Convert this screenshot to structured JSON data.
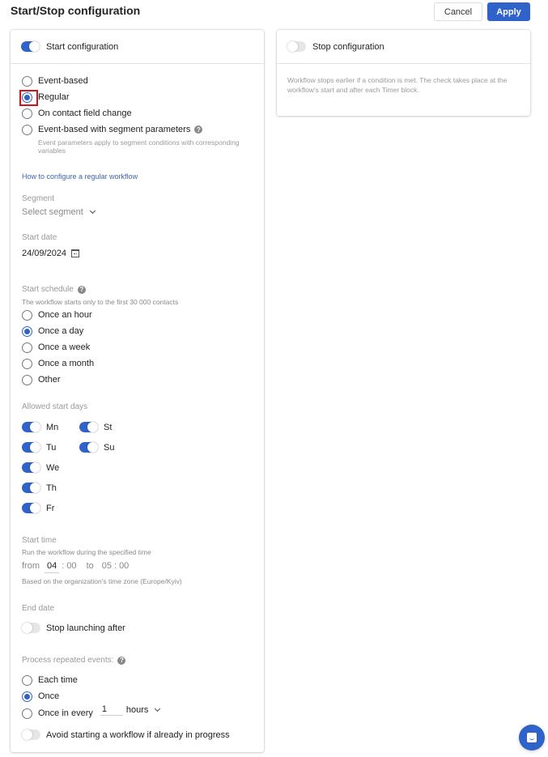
{
  "header": {
    "title": "Start/Stop configuration",
    "cancel_label": "Cancel",
    "apply_label": "Apply"
  },
  "colors": {
    "accent": "#2f63c9",
    "focus_outline": "#d0141c"
  },
  "start_card": {
    "toggle_label": "Start configuration",
    "toggle_on": true,
    "trigger_options": [
      {
        "label": "Event-based",
        "checked": false
      },
      {
        "label": "Regular",
        "checked": true
      },
      {
        "label": "On contact field change",
        "checked": false
      },
      {
        "label": "Event-based with segment parameters",
        "checked": false
      }
    ],
    "segment_params_note": "Event parameters apply to segment conditions with corresponding variables",
    "help_link": "How to configure a regular workflow",
    "segment": {
      "label": "Segment",
      "placeholder": "Select segment"
    },
    "start_date": {
      "label": "Start date",
      "value": "24/09/2024"
    },
    "start_schedule": {
      "label": "Start schedule",
      "note": "The workflow starts only to the first 30 000 contacts",
      "options": [
        {
          "label": "Once an hour",
          "checked": false
        },
        {
          "label": "Once a day",
          "checked": true
        },
        {
          "label": "Once a week",
          "checked": false
        },
        {
          "label": "Once a month",
          "checked": false
        },
        {
          "label": "Other",
          "checked": false
        }
      ]
    },
    "allowed_days": {
      "label": "Allowed start days",
      "days": [
        {
          "label": "Mn",
          "on": true
        },
        {
          "label": "Tu",
          "on": true
        },
        {
          "label": "We",
          "on": true
        },
        {
          "label": "Th",
          "on": true
        },
        {
          "label": "Fr",
          "on": true
        },
        {
          "label": "St",
          "on": true
        },
        {
          "label": "Su",
          "on": true
        }
      ]
    },
    "start_time": {
      "label": "Start time",
      "note": "Run the workflow during the specified time",
      "from_label": "from",
      "from_hour": "04",
      "from_minute": "00",
      "to_label": "to",
      "to_hour": "05",
      "to_minute": "00",
      "separator": ":",
      "timezone_note": "Based on the organization's time zone (Europe/Kyiv)"
    },
    "end_date": {
      "label": "End date",
      "toggle_label": "Stop launching after",
      "toggle_on": false
    },
    "repeated_events": {
      "label": "Process repeated events:",
      "options": [
        {
          "label": "Each time",
          "checked": false
        },
        {
          "label": "Once",
          "checked": true
        },
        {
          "label": "Once in every",
          "checked": false
        }
      ],
      "interval_value": "1",
      "interval_unit": "hours",
      "avoid_toggle_label": "Avoid starting a workflow if already in progress",
      "avoid_toggle_on": false
    }
  },
  "stop_card": {
    "toggle_label": "Stop configuration",
    "toggle_on": false,
    "description": "Workflow stops earlier if a condition is met. The check takes place at the workflow's start and after each Timer block."
  },
  "icons": {
    "help": "?"
  }
}
